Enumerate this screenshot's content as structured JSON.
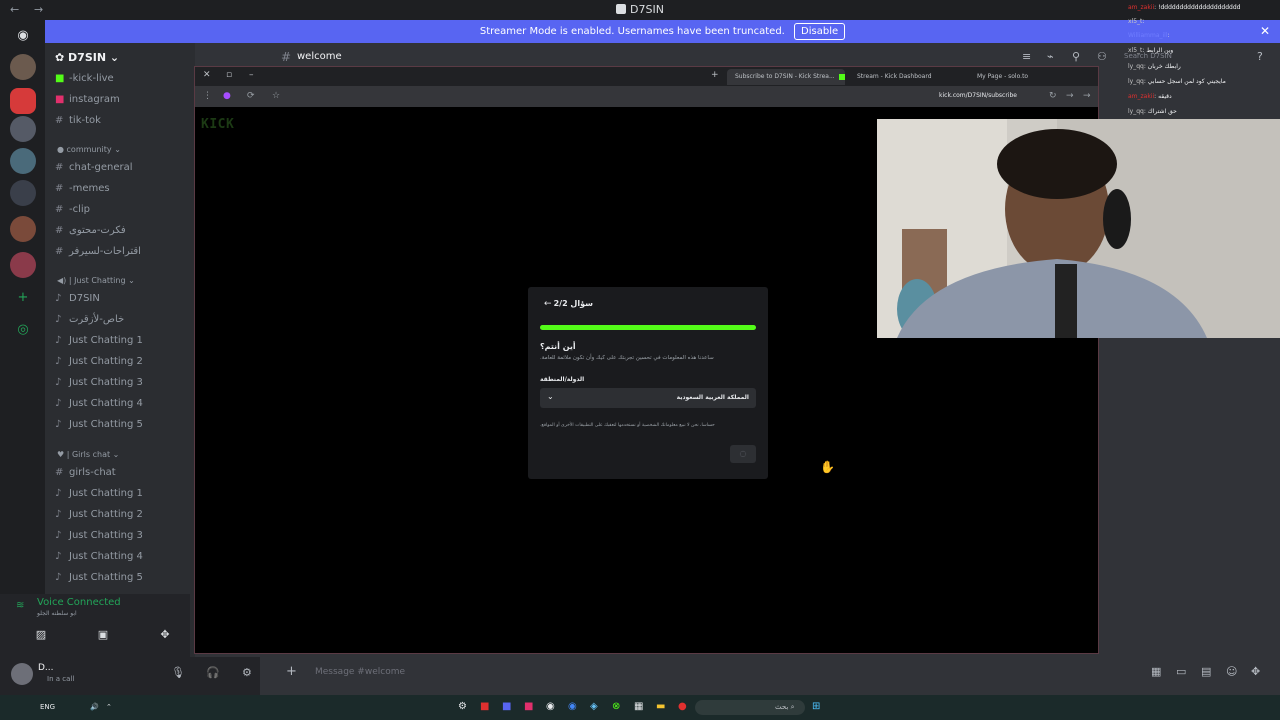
{
  "window": {
    "title": "D7SIN",
    "back": "←",
    "forward": "→"
  },
  "banner": {
    "text": "Streamer Mode is enabled. Usernames have been truncated.",
    "button": "Disable",
    "close": "✕"
  },
  "server": {
    "name": "D7SIN",
    "dropdown": "⌄"
  },
  "channels": [
    {
      "label": "-kick-live",
      "icon": "kick-icon"
    },
    {
      "label": "instagram",
      "icon": "instagram-icon"
    },
    {
      "label": "tik-tok",
      "icon": "hash-icon"
    }
  ],
  "categories": {
    "community": "community",
    "just_chatting": "| Just Chatting",
    "girls_chat": "| Girls chat"
  },
  "community_channels": [
    "chat-general",
    "-memes",
    "-clip",
    "فكرت-محتوى",
    "اقتراحات-لسيرفر"
  ],
  "voice_channels_a": [
    "D7SIN",
    "خاص-لأزقرت",
    "Just Chatting 1",
    "Just Chatting 2",
    "Just Chatting 3",
    "Just Chatting 4",
    "Just Chatting 5"
  ],
  "girls_channels": [
    "girls-chat",
    "Just Chatting 1",
    "Just Chatting 2",
    "Just Chatting 3",
    "Just Chatting 4",
    "Just Chatting 5"
  ],
  "voice": {
    "status": "Voice Connected",
    "sub": "ابو سلطنه الجلو"
  },
  "user": {
    "name": "D...",
    "status": "In a call"
  },
  "chat": {
    "channel": "welcome",
    "placeholder": "Message #welcome"
  },
  "browser": {
    "tabs": [
      {
        "label": "Subscribe to D7SIN - Kick Strea..."
      },
      {
        "label": "Stream - Kick Dashboard"
      },
      {
        "label": "My Page - solo.to"
      }
    ],
    "url": "kick.com/D7SIN/subscribe",
    "new_tab": "+",
    "logo": "KICK"
  },
  "modal": {
    "step": "سؤال 2/2",
    "progress": 1.0,
    "question": "أين أنتم؟",
    "description": "ساعدنا هذه المعلومات في تحسين تجربتك على كيك وأن تكون ملائمة للعامة.",
    "field_label": "الدولة/المنطقة",
    "selected": "المملكة العربية السعودية",
    "note": "حساسا، نحن لا نبيع معلوماتك الشخصية أو نستخدمها لتعقبك على التطبيقات الأخرى أو المواقع."
  },
  "overlay_chat": [
    {
      "user": "am_zakii",
      "msg": "!ddddddddddddddddddddd",
      "color": "red"
    },
    {
      "user": "xl5_t",
      "msg": "",
      "color": "grey"
    },
    {
      "user": "Williamma_ill",
      "msg": "",
      "color": "blue"
    },
    {
      "user": "xl5_t",
      "msg": "وين الرابط",
      "color": "grey"
    },
    {
      "user": "ly_qq",
      "msg": "رابطك خربان",
      "color": "grey"
    },
    {
      "user": "ly_qq",
      "msg": "مايجيني كود لمن اسجل حسابي",
      "color": "grey"
    },
    {
      "user": "am_zakii",
      "msg": "دقيقه",
      "color": "red"
    },
    {
      "user": "ly_qq",
      "msg": "حق اشتراك",
      "color": "grey"
    }
  ],
  "search_placeholder": "Search D7SIN",
  "taskbar": {
    "time": "",
    "lang": "ENG",
    "search": "بحث"
  },
  "colors": {
    "discord_blurple": "#5865f2",
    "kick_green": "#53fc18",
    "voice_green": "#23a559"
  }
}
